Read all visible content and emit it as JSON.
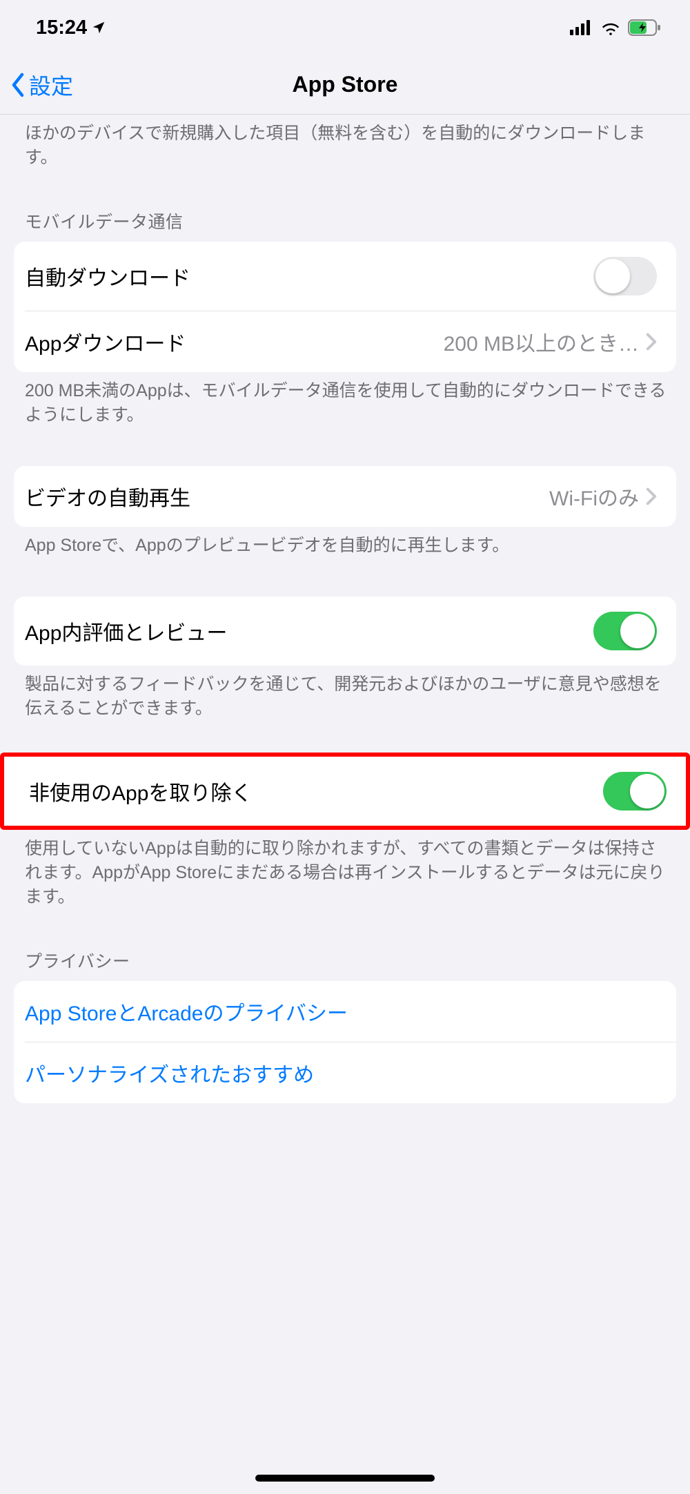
{
  "status": {
    "time": "15:24"
  },
  "nav": {
    "back": "設定",
    "title": "App Store"
  },
  "top_footer": "ほかのデバイスで新規購入した項目（無料を含む）を自動的にダウンロードします。",
  "cellular": {
    "header": "モバイルデータ通信",
    "auto_dl": "自動ダウンロード",
    "app_dl": "Appダウンロード",
    "app_dl_detail": "200 MB以上のとき…",
    "footer": "200 MB未満のAppは、モバイルデータ通信を使用して自動的にダウンロードできるようにします。"
  },
  "video": {
    "label": "ビデオの自動再生",
    "detail": "Wi-Fiのみ",
    "footer": "App Storeで、Appのプレビュービデオを自動的に再生します。"
  },
  "rating": {
    "label": "App内評価とレビュー",
    "footer": "製品に対するフィードバックを通じて、開発元およびほかのユーザに意見や感想を伝えることができます。"
  },
  "offload": {
    "label": "非使用のAppを取り除く",
    "footer": "使用していないAppは自動的に取り除かれますが、すべての書類とデータは保持されます。AppがApp Storeにまだある場合は再インストールするとデータは元に戻ります。"
  },
  "privacy": {
    "header": "プライバシー",
    "row1": "App StoreとArcadeのプライバシー",
    "row2": "パーソナライズされたおすすめ"
  }
}
